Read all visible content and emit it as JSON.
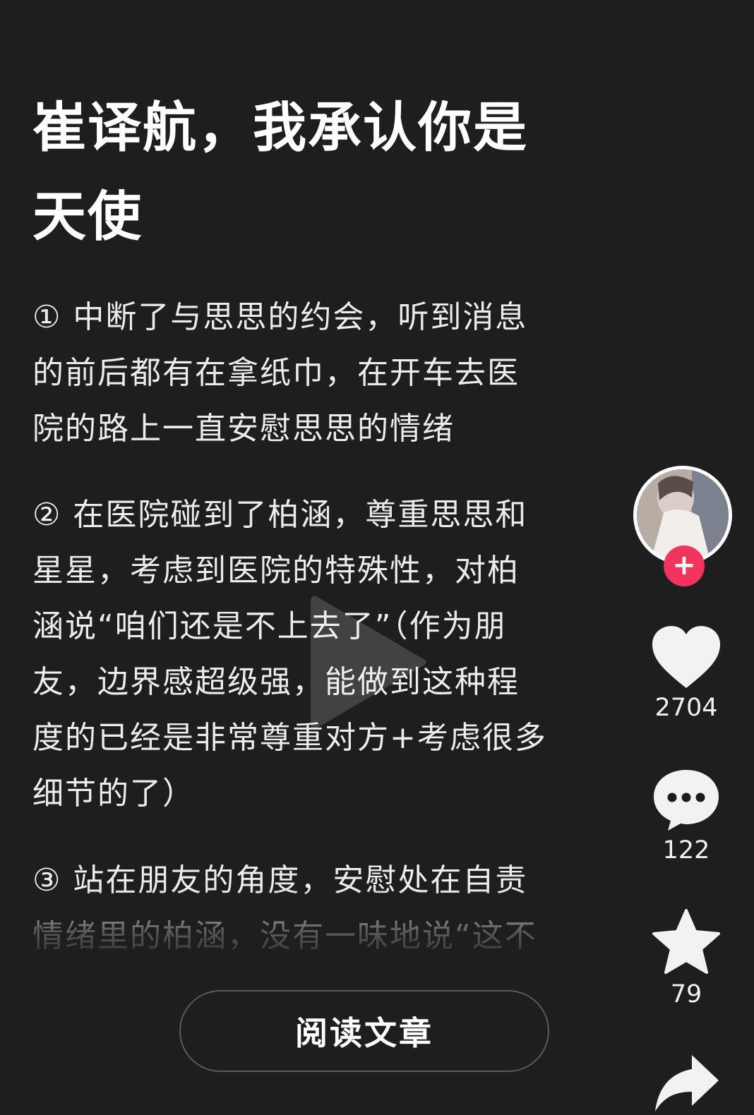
{
  "article": {
    "title_line1": "崔译航，我承认你是",
    "title_line2": "天使",
    "para1": [
      "① 中断了与思思的约会，听到消息",
      "的前后都有在拿纸巾，在开车去医",
      "院的路上一直安慰思思的情绪"
    ],
    "para2": [
      "② 在医院碰到了柏涵，尊重思思和",
      "星星，考虑到医院的特殊性，对柏",
      "涵说“咱们还是不上去了”（作为朋",
      "友，边界感超级强，能做到这种程",
      "度的已经是非常尊重对方+考虑很多",
      "细节的了）"
    ],
    "para3": [
      "③ 站在朋友的角度，安慰处在自责",
      "情绪里的柏涵，没有一味地说“这不"
    ]
  },
  "read_button_label": "阅读文章",
  "rail": {
    "follow_symbol": "+",
    "likes": "2704",
    "comments": "122",
    "favorites": "79"
  },
  "icons": {
    "avatar": "avatar",
    "follow": "plus-icon",
    "like": "heart-icon",
    "comment": "speech-bubble-icon",
    "favorite": "star-icon",
    "share": "share-arrow-icon",
    "overlay": "play-icon"
  },
  "colors": {
    "background": "#1e1e1f",
    "accent": "#f0345b",
    "text": "#ffffff"
  }
}
